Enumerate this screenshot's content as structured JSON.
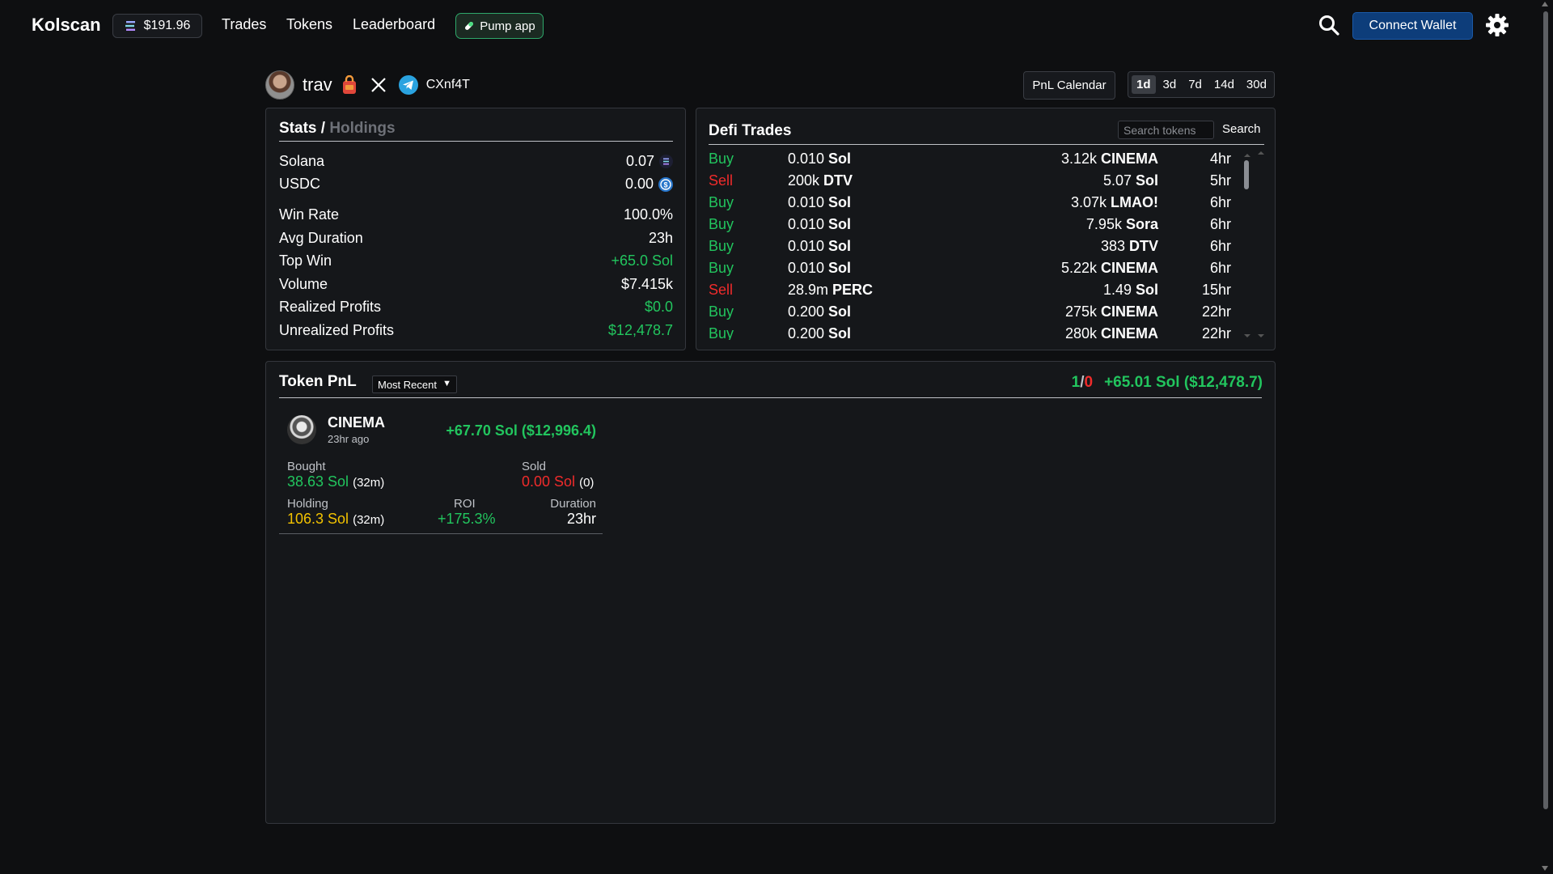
{
  "nav": {
    "brand": "Kolscan",
    "sol_price": "$191.96",
    "links": [
      "Trades",
      "Tokens",
      "Leaderboard"
    ],
    "pump_label": "Pump app",
    "connect_label": "Connect Wallet",
    "icons": [
      "solana-icon",
      "pill-icon",
      "search-icon",
      "gear-icon"
    ]
  },
  "profile": {
    "name": "trav",
    "wallet": "CXnf4T",
    "icons": [
      "avatar",
      "bag-icon",
      "x-icon",
      "telegram-icon"
    ]
  },
  "controls": {
    "pnl_calendar": "PnL Calendar",
    "ranges": [
      "1d",
      "3d",
      "7d",
      "14d",
      "30d"
    ],
    "active_range": "1d"
  },
  "stats": {
    "title": "Stats /",
    "title_alt": "Holdings",
    "balances": [
      {
        "label": "Solana",
        "value": "0.07",
        "icon": "solana-icon"
      },
      {
        "label": "USDC",
        "value": "0.00",
        "icon": "usdc-icon"
      }
    ],
    "rows": [
      {
        "label": "Win Rate",
        "value": "100.0%",
        "color": "#ffffff"
      },
      {
        "label": "Avg Duration",
        "value": "23h",
        "color": "#ffffff"
      },
      {
        "label": "Top Win",
        "value": "+65.0 Sol",
        "color": "#22c55e"
      },
      {
        "label": "Volume",
        "value": "$7.415k",
        "color": "#ffffff"
      },
      {
        "label": "Realized Profits",
        "value": "$0.0",
        "color": "#22c55e"
      },
      {
        "label": "Unrealized Profits",
        "value": "$12,478.7",
        "color": "#22c55e"
      }
    ]
  },
  "defi": {
    "title": "Defi Trades",
    "search_placeholder": "Search tokens",
    "search_button": "Search",
    "trades": [
      {
        "side": "Buy",
        "left_num": "0.010",
        "left_tok": "Sol",
        "right_num": "3.12k",
        "right_tok": "CINEMA",
        "age": "4hr"
      },
      {
        "side": "Sell",
        "left_num": "200k",
        "left_tok": "DTV",
        "right_num": "5.07",
        "right_tok": "Sol",
        "age": "5hr"
      },
      {
        "side": "Buy",
        "left_num": "0.010",
        "left_tok": "Sol",
        "right_num": "3.07k",
        "right_tok": "LMAO!",
        "age": "6hr"
      },
      {
        "side": "Buy",
        "left_num": "0.010",
        "left_tok": "Sol",
        "right_num": "7.95k",
        "right_tok": "Sora",
        "age": "6hr"
      },
      {
        "side": "Buy",
        "left_num": "0.010",
        "left_tok": "Sol",
        "right_num": "383",
        "right_tok": "DTV",
        "age": "6hr"
      },
      {
        "side": "Buy",
        "left_num": "0.010",
        "left_tok": "Sol",
        "right_num": "5.22k",
        "right_tok": "CINEMA",
        "age": "6hr"
      },
      {
        "side": "Sell",
        "left_num": "28.9m",
        "left_tok": "PERC",
        "right_num": "1.49",
        "right_tok": "Sol",
        "age": "15hr"
      },
      {
        "side": "Buy",
        "left_num": "0.200",
        "left_tok": "Sol",
        "right_num": "275k",
        "right_tok": "CINEMA",
        "age": "22hr"
      },
      {
        "side": "Buy",
        "left_num": "0.200",
        "left_tok": "Sol",
        "right_num": "280k",
        "right_tok": "CINEMA",
        "age": "22hr"
      }
    ]
  },
  "token_pnl": {
    "title": "Token PnL",
    "sort_label": "Most Recent",
    "wins": "1",
    "separator": "/",
    "losses": "0",
    "total": "+65.01 Sol ($12,478.7)",
    "card": {
      "name": "CINEMA",
      "time": "23hr ago",
      "pnl": "+67.70 Sol ($12,996.4)",
      "bought_label": "Bought",
      "bought_value": "38.63 Sol",
      "bought_sub": "(32m)",
      "sold_label": "Sold",
      "sold_value": "0.00 Sol",
      "sold_sub": "(0)",
      "holding_label": "Holding",
      "holding_value": "106.3 Sol",
      "holding_sub": "(32m)",
      "roi_label": "ROI",
      "roi_value": "+175.3%",
      "duration_label": "Duration",
      "duration_value": "23hr"
    }
  },
  "colors": {
    "green": "#22c55e",
    "red": "#ef2b2b",
    "yellow": "#f2c200",
    "accent_blue": "#0d3d7a"
  }
}
